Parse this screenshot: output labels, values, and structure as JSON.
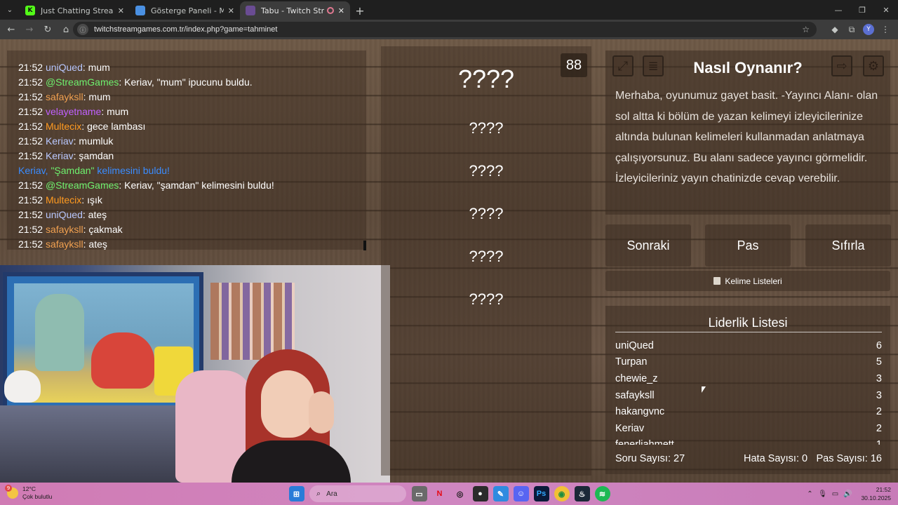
{
  "browser": {
    "tabs": [
      {
        "title": "Just Chatting Streaming - Live S",
        "favicon": "K",
        "favicon_color": "#53fc18",
        "active": false
      },
      {
        "title": "Gösterge Paneli - MissXss AI Bo",
        "favicon": "",
        "favicon_color": "#4a90e2",
        "active": false
      },
      {
        "title": "Tabu - Twitch Stream Games",
        "favicon": "",
        "favicon_color": "#6a4c93",
        "active": true
      }
    ],
    "url": "twitchstreamgames.com.tr/index.php?game=tahminet",
    "profile_initial": "Y"
  },
  "chat": {
    "lines": [
      {
        "time": "21:52",
        "user": "uniQued",
        "user_color": "#b9c8ff",
        "text": ": mum"
      },
      {
        "time": "21:52",
        "user": "@StreamGames",
        "user_color": "#6ef06e",
        "text": ": Keriav, \"mum\" ipucunu buldu."
      },
      {
        "time": "21:52",
        "user": "safayksll",
        "user_color": "#f0a050",
        "text": ": mum"
      },
      {
        "time": "21:52",
        "user": "velayetname",
        "user_color": "#c060ff",
        "text": ": mum"
      },
      {
        "time": "21:52",
        "user": "Multecix",
        "user_color": "#ff9a20",
        "text": ": gece lambası"
      },
      {
        "time": "21:52",
        "user": "Keriav",
        "user_color": "#b9c8ff",
        "text": ": mumluk"
      },
      {
        "time": "21:52",
        "user": "Keriav",
        "user_color": "#b9c8ff",
        "text": ": şamdan"
      },
      {
        "time": "",
        "user": "Keriav, ",
        "user_color": "#3a8cff",
        "highlight": "\"Şamdan\"",
        "highlight_color": "#6ef06e",
        "text": " kelimesini buldu!",
        "text_color": "#3a8cff"
      },
      {
        "time": "21:52",
        "user": "@StreamGames",
        "user_color": "#6ef06e",
        "text": ": Keriav, \"şamdan\" kelimesini buldu!"
      },
      {
        "time": "21:52",
        "user": "Multecix",
        "user_color": "#ff9a20",
        "text": ": ışık"
      },
      {
        "time": "21:52",
        "user": "uniQued",
        "user_color": "#b9c8ff",
        "text": ": ateş"
      },
      {
        "time": "21:52",
        "user": "safayksll",
        "user_color": "#f0a050",
        "text": ": çakmak"
      },
      {
        "time": "21:52",
        "user": "safayksll",
        "user_color": "#f0a050",
        "text": ": ateş"
      }
    ]
  },
  "game": {
    "counter": "88",
    "main_word": "????",
    "taboo_words": [
      "????",
      "????",
      "????",
      "????",
      "????"
    ]
  },
  "howto": {
    "title": "Nasıl Oynanır?",
    "text": "Merhaba, oyunumuz gayet basit. -Yayıncı Alanı- olan sol altta ki bölüm de yazan kelimeyi izleyicilerinize altında bulunan kelimeleri kullanmadan anlatmaya çalışıyorsunuz. Bu alanı sadece yayıncı görmelidir. İzleyicileriniz yayın chatinizde cevap verebilir.",
    "icons": [
      "fullscreen-icon",
      "document-icon",
      "exit-icon",
      "gear-icon"
    ]
  },
  "controls": {
    "next": "Sonraki",
    "pass": "Pas",
    "reset": "Sıfırla",
    "word_lists": "Kelime Listeleri"
  },
  "leaderboard": {
    "title": "Liderlik Listesi",
    "rows": [
      {
        "name": "uniQued",
        "score": "6"
      },
      {
        "name": "Turpan",
        "score": "5"
      },
      {
        "name": "chewie_z",
        "score": "3"
      },
      {
        "name": "safayksll",
        "score": "3"
      },
      {
        "name": "hakangvnc",
        "score": "2"
      },
      {
        "name": "Keriav",
        "score": "2"
      },
      {
        "name": "fenerliahmett",
        "score": "1"
      }
    ],
    "stats": {
      "questions": "Soru Sayısı: 27",
      "errors": "Hata Sayısı: 0",
      "passes": "Pas Sayısı: 16"
    }
  },
  "taskbar": {
    "weather_temp": "12°C",
    "weather_desc": "Çok bulutlu",
    "weather_badge": "9",
    "search_placeholder": "Ara",
    "time": "21:52",
    "date": "30.10.2025"
  }
}
